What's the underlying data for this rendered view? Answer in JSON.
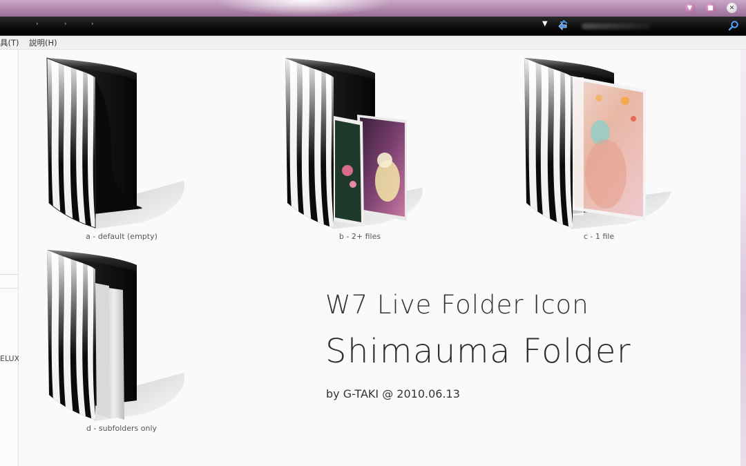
{
  "window": {
    "minimize_glyph": "▼",
    "maximize_glyph": "■",
    "close_glyph": "✕"
  },
  "address_bar": {
    "separators": [
      "›",
      "›",
      "›"
    ],
    "dropdown_glyph": "▼"
  },
  "menubar": {
    "items": [
      {
        "label": "具(T)"
      },
      {
        "label": "説明(H)"
      }
    ]
  },
  "sidebar": {
    "partial_text": "ELUX"
  },
  "folders": [
    {
      "label": "a - default (empty)",
      "variant": "empty"
    },
    {
      "label": "b - 2+ files",
      "variant": "files"
    },
    {
      "label": "c - 1 file",
      "variant": "one-file"
    },
    {
      "label": "d - subfolders only",
      "variant": "subfolders"
    }
  ],
  "heading": {
    "line1": "W7 Live Folder Icon",
    "line2": "Shimauma Folder",
    "byline": "by G-TAKI @ 2010.06.13"
  },
  "colors": {
    "titlebar": "#9c6d97",
    "addressbar": "#0c0c0c",
    "content_bg": "#fafafa",
    "folder_black": "#111111",
    "stripe_white": "#f4f4f4"
  },
  "icons": {
    "refresh": "refresh-icon",
    "search": "search-icon",
    "dropdown": "chevron-down-icon"
  }
}
